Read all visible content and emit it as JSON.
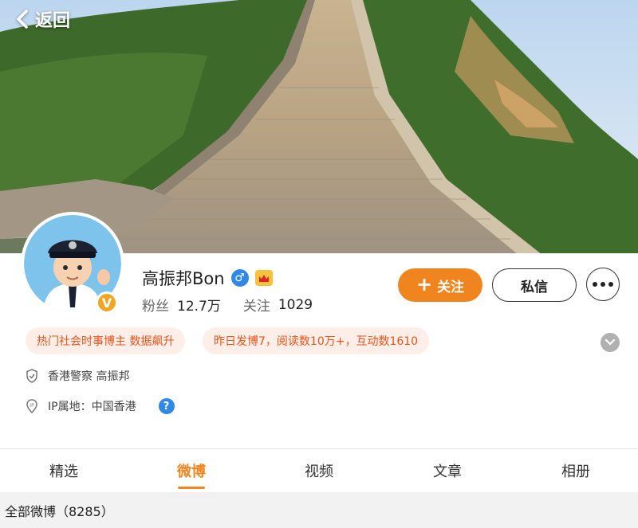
{
  "nav": {
    "back_label": "返回"
  },
  "profile": {
    "name": "高振邦Bon",
    "gender_symbol": "♂",
    "verified_badge": "V",
    "followers_label": "粉丝",
    "followers_count": "12.7万",
    "following_label": "关注",
    "following_count": "1029"
  },
  "actions": {
    "follow_label": "关注",
    "message_label": "私信"
  },
  "tags": [
    {
      "text": "热门社会时事博主 数据飙升"
    },
    {
      "text": "昨日发博7，阅读数10万+，互动数1610"
    }
  ],
  "info": {
    "verification": "香港警察 高振邦",
    "ip_location": "IP属地：中国香港"
  },
  "tabs": [
    {
      "label": "精选"
    },
    {
      "label": "微博"
    },
    {
      "label": "视频"
    },
    {
      "label": "文章"
    },
    {
      "label": "相册"
    }
  ],
  "active_tab": "微博",
  "feed": {
    "all_posts_label": "全部微博（8285）"
  },
  "colors": {
    "accent": "#f0851f",
    "tag_text": "#e8531c",
    "tag_bg": "#fdeee8",
    "link_blue": "#2f88e6"
  },
  "icons": [
    "back-arrow-icon",
    "gender-male-icon",
    "level-badge-icon",
    "verified-v-icon",
    "more-dots-icon",
    "expand-chevron-icon",
    "shield-icon",
    "ip-location-icon",
    "help-icon"
  ]
}
